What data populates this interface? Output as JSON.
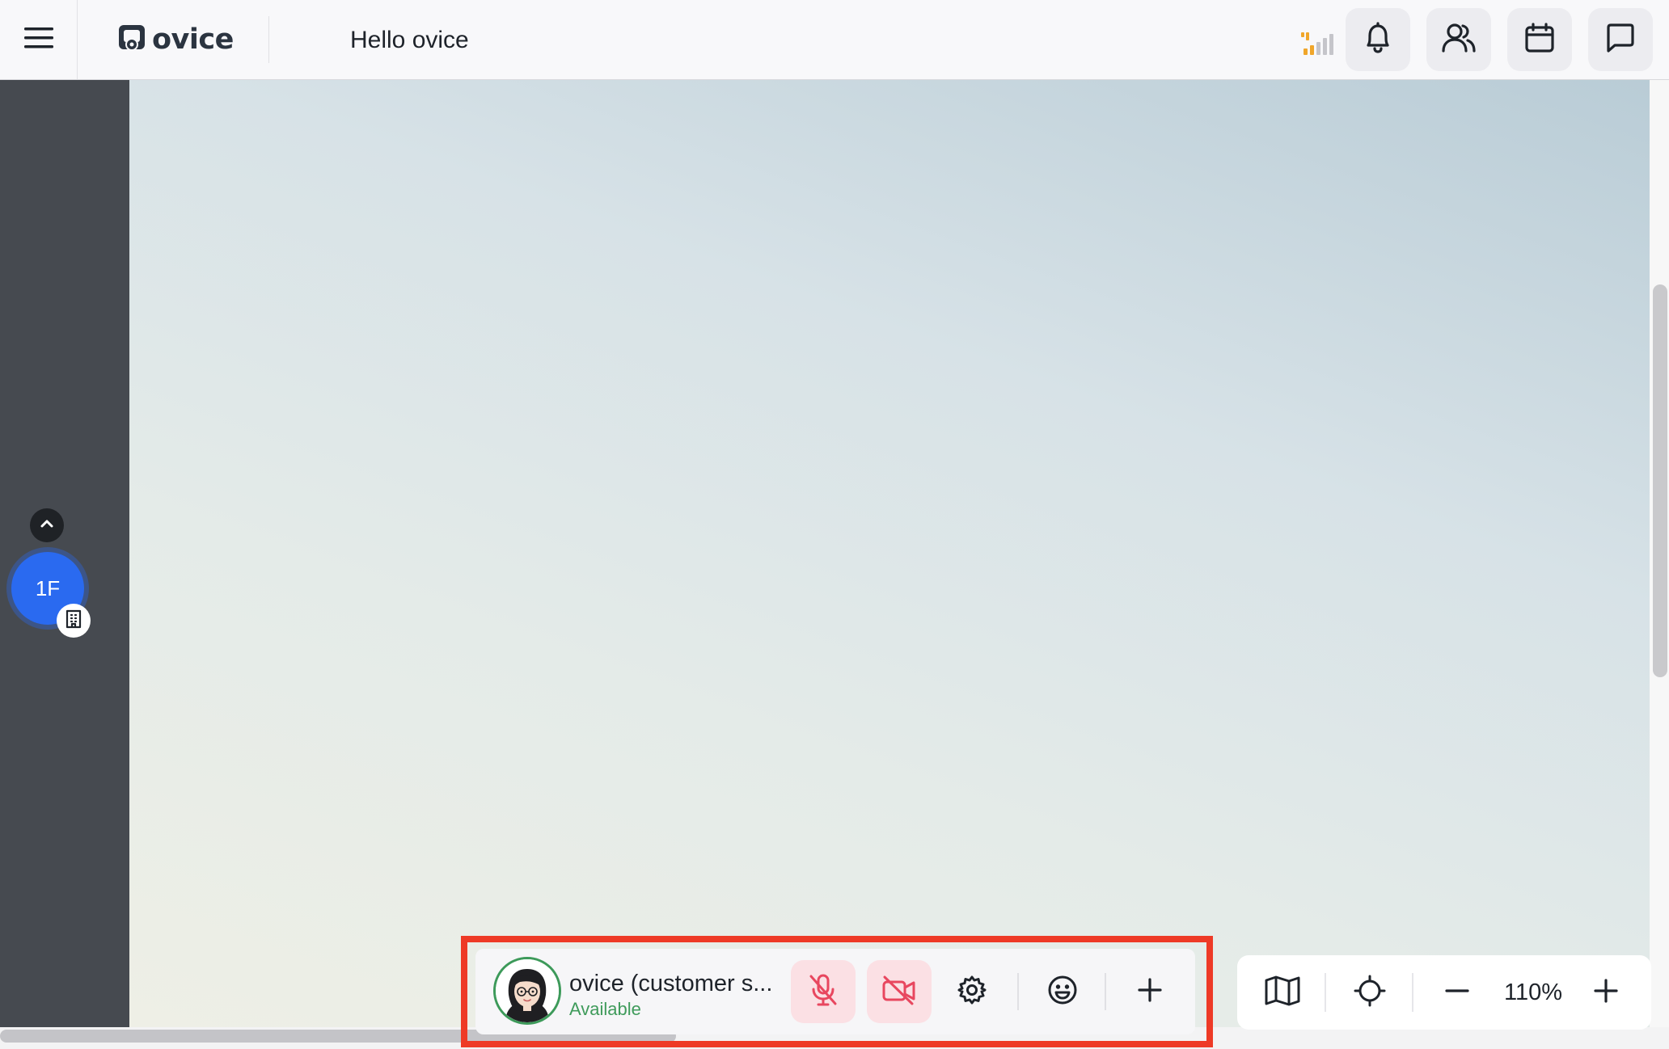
{
  "header": {
    "logo_text": "ovice",
    "space_title": "Hello ovice",
    "icons": {
      "menu": "hamburger-menu-icon",
      "signal": "signal-strength-icon",
      "notifications": "bell-icon",
      "members": "users-icon",
      "calendar": "calendar-icon",
      "chat": "chat-icon"
    },
    "signal_color": "#f0a62a"
  },
  "floors": {
    "current_label": "1F",
    "accent": "#2a6af0",
    "up_icon": "chevron-up-icon",
    "building_icon": "building-icon"
  },
  "user_bar": {
    "name": "ovice (customer s...",
    "status": "Available",
    "status_color": "#3f9b5b",
    "highlight_color": "#ee3a26",
    "icons": {
      "mic": "mic-muted-icon",
      "camera": "camera-off-icon",
      "settings": "gear-icon",
      "reaction": "smiley-icon",
      "more": "plus-icon"
    },
    "muted_color": "#e8475f"
  },
  "map_bar": {
    "zoom": "110%",
    "icons": {
      "map": "map-icon",
      "locate": "crosshair-icon",
      "zoom_out": "minus-icon",
      "zoom_in": "plus-icon"
    }
  }
}
